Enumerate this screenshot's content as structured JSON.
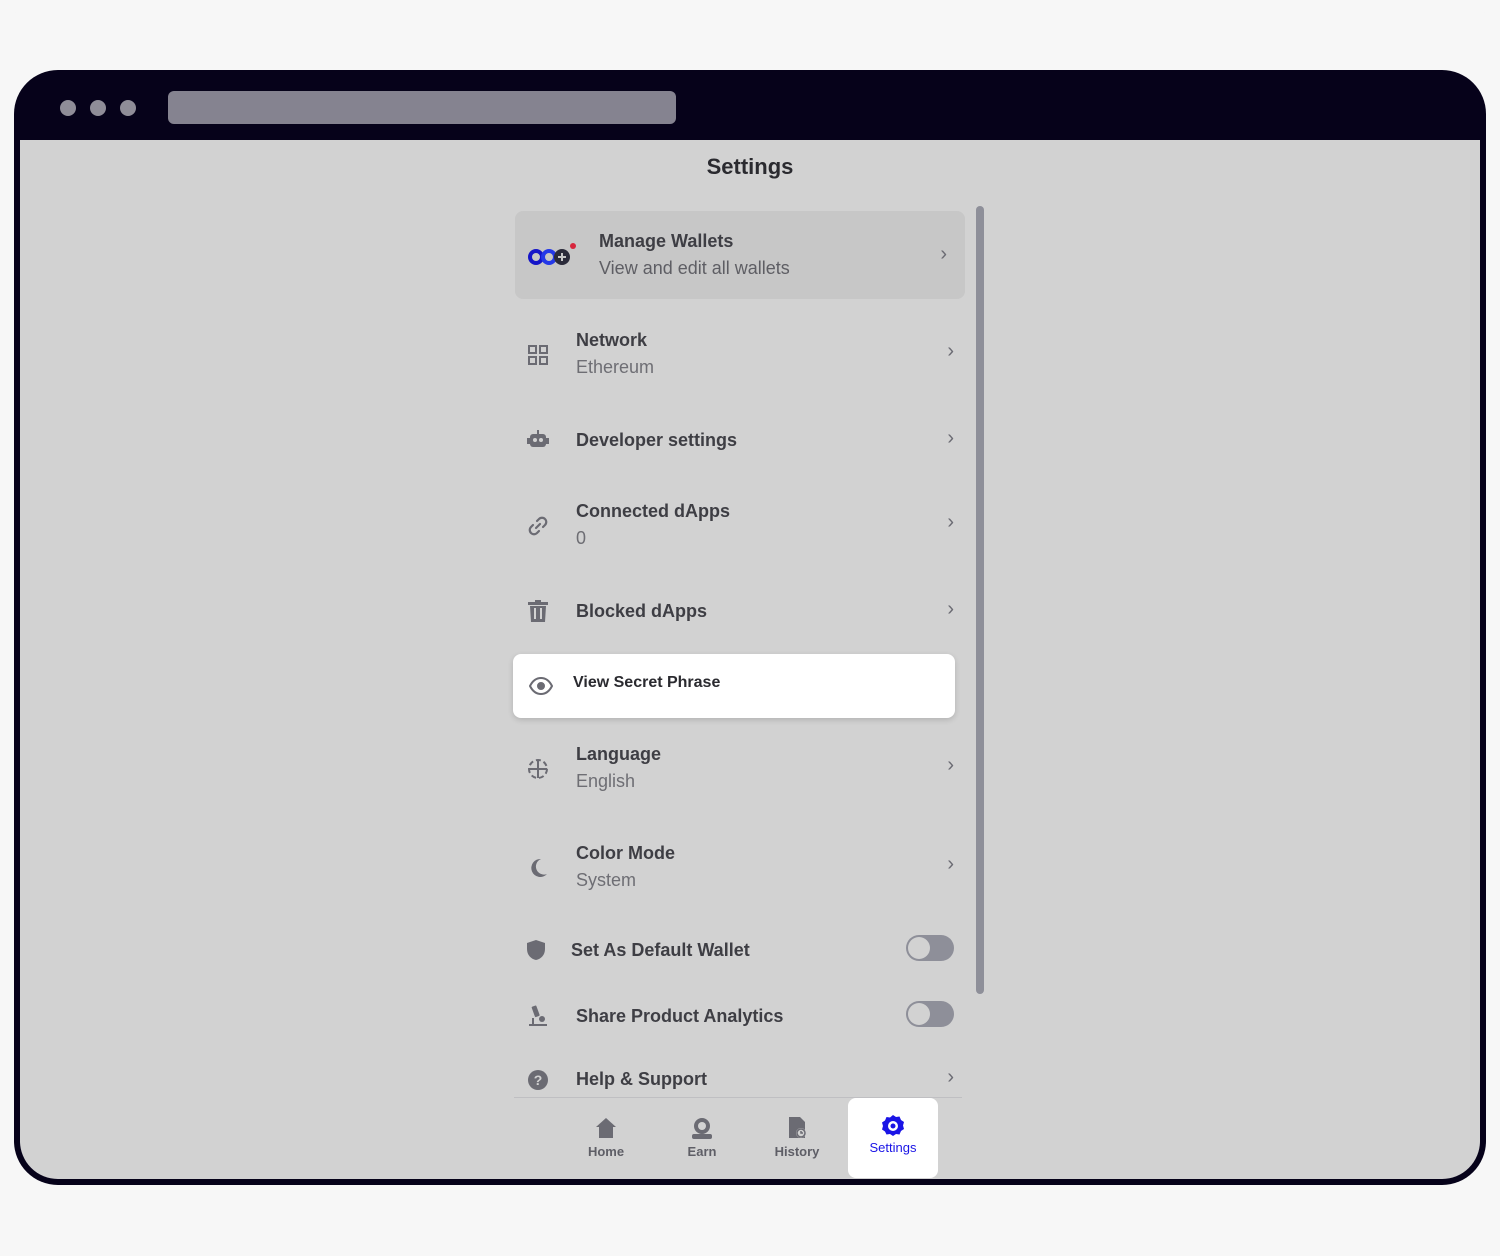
{
  "page_title": "Settings",
  "colors": {
    "accent": "#1a14e6",
    "wallet_red": "#d7263d",
    "wallet_blue": "#1515c8"
  },
  "wallets": {
    "title": "Manage Wallets",
    "subtitle": "View and edit all wallets",
    "icon": "wallet-stack-icon"
  },
  "items": [
    {
      "title": "Network",
      "subtitle": "Ethereum",
      "icon": "network-grid-icon"
    },
    {
      "title": "Developer settings",
      "icon": "robot-icon"
    },
    {
      "title": "Connected dApps",
      "subtitle": "0",
      "icon": "link-icon"
    },
    {
      "title": "Blocked dApps",
      "icon": "trash-icon"
    },
    {
      "title": "View Secret Phrase",
      "icon": "eye-icon"
    },
    {
      "title": "Language",
      "subtitle": "English",
      "icon": "globe-icon"
    },
    {
      "title": "Color Mode",
      "subtitle": "System",
      "icon": "moon-icon"
    },
    {
      "title": "Set As Default Wallet",
      "icon": "shield-icon",
      "toggle": false
    },
    {
      "title": "Share Product Analytics",
      "icon": "microscope-icon",
      "toggle": false
    },
    {
      "title": "Help & Support",
      "icon": "help-circle-icon"
    }
  ],
  "tabs": [
    {
      "label": "Home",
      "icon": "home-icon"
    },
    {
      "label": "Earn",
      "icon": "earn-icon"
    },
    {
      "label": "History",
      "icon": "history-icon"
    },
    {
      "label": "Settings",
      "icon": "settings-gear-icon",
      "active": true
    }
  ]
}
